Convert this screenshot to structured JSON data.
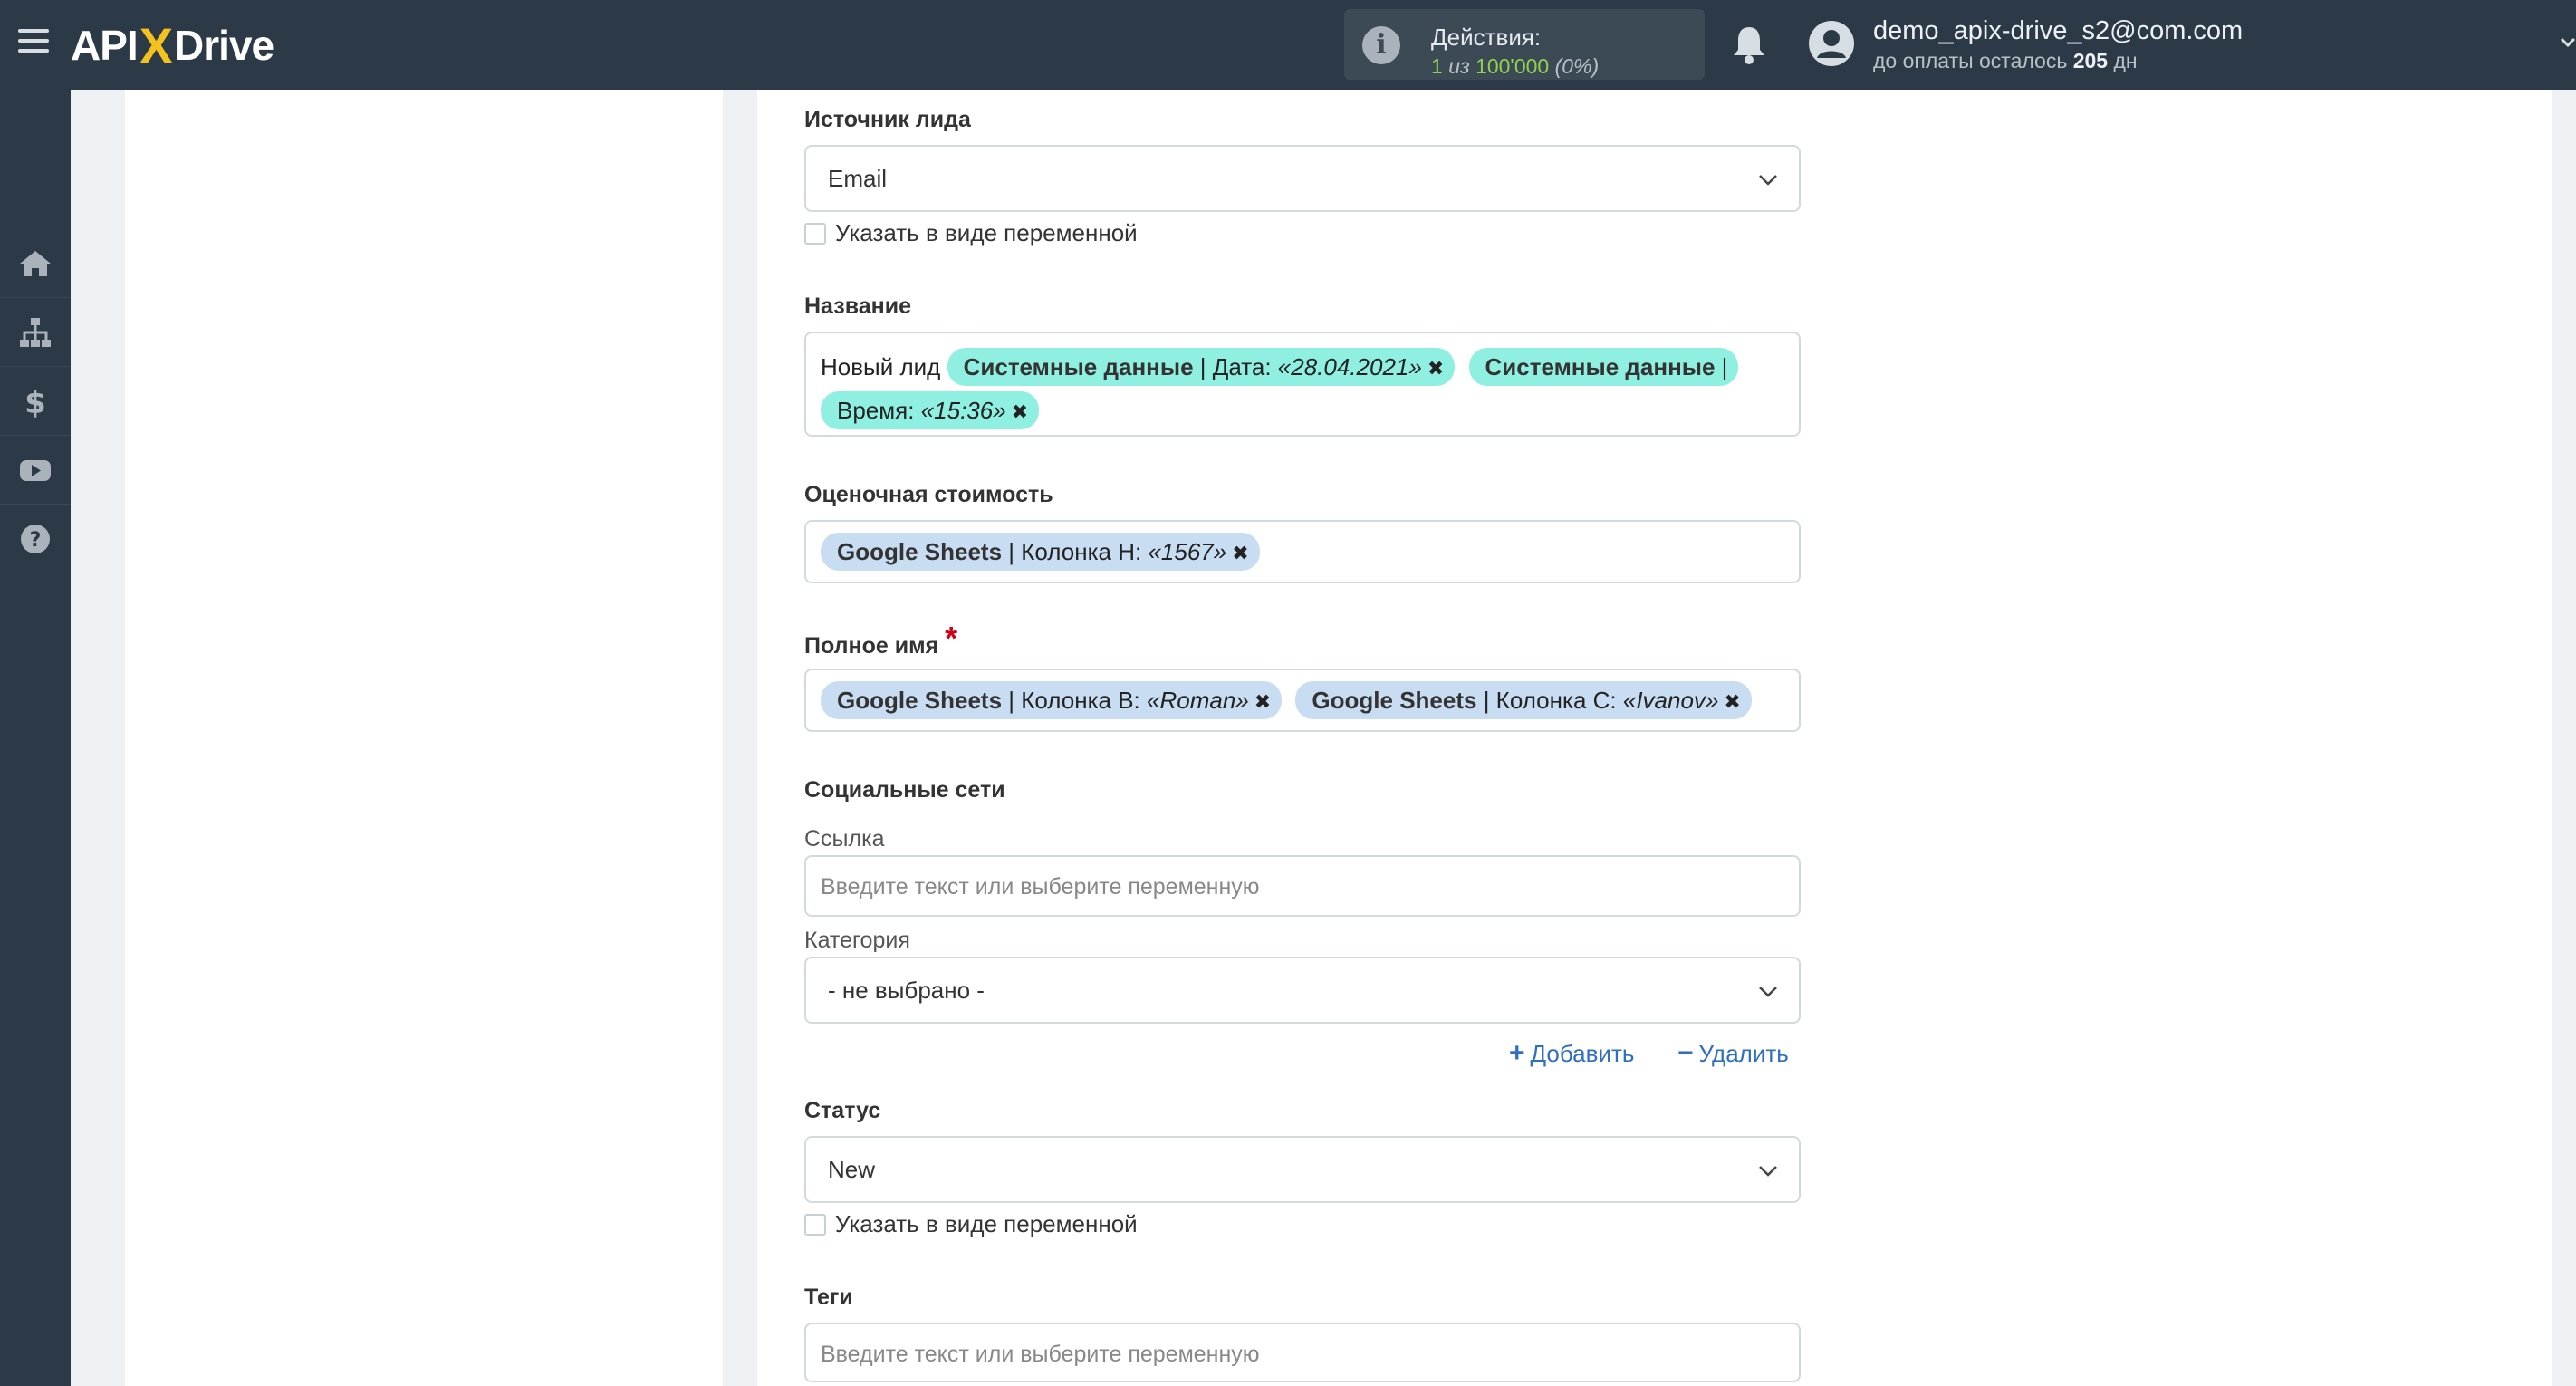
{
  "header": {
    "logo_api": "API",
    "logo_x": "X",
    "logo_drive": "Drive",
    "actions": {
      "title": "Действия:",
      "used": "1",
      "of_text": "из",
      "limit": "100'000",
      "percent": "(0%)"
    },
    "user": {
      "email": "demo_apix-drive_s2@com.com",
      "sub_prefix": "до оплаты осталось",
      "days": "205",
      "sub_suffix": "дн"
    }
  },
  "sidebar": {
    "items": [
      {
        "icon": "home-icon"
      },
      {
        "icon": "sitemap-icon"
      },
      {
        "icon": "dollar-icon"
      },
      {
        "icon": "youtube-icon"
      },
      {
        "icon": "help-icon"
      }
    ]
  },
  "form": {
    "lead_source": {
      "label": "Источник лида",
      "value": "Email",
      "checkbox_label": "Указать в виде переменной"
    },
    "name": {
      "label": "Название",
      "prefix_text": "Новый лид",
      "tags": [
        {
          "source": "Системные данные",
          "field": "| Дата:",
          "value": "«28.04.2021»"
        },
        {
          "source": "Системные данные",
          "field": "| Время:",
          "value": "«15:36»"
        }
      ]
    },
    "estimated_cost": {
      "label": "Оценочная стоимость",
      "tags": [
        {
          "source": "Google Sheets",
          "field": "| Колонка H:",
          "value": "«1567»"
        }
      ]
    },
    "full_name": {
      "label": "Полное имя",
      "required_mark": "*",
      "tags": [
        {
          "source": "Google Sheets",
          "field": "| Колонка B:",
          "value": "«Roman»"
        },
        {
          "source": "Google Sheets",
          "field": "| Колонка C:",
          "value": "«Ivanov»"
        }
      ]
    },
    "social": {
      "label": "Социальные сети",
      "link_label": "Ссылка",
      "link_placeholder": "Введите текст или выберите переменную",
      "category_label": "Категория",
      "category_value": "- не выбрано -",
      "add_label": "Добавить",
      "remove_label": "Удалить"
    },
    "status": {
      "label": "Статус",
      "value": "New",
      "checkbox_label": "Указать в виде переменной"
    },
    "tags_field": {
      "label": "Теги",
      "placeholder": "Введите текст или выберите переменную"
    }
  },
  "colors": {
    "topbar": "#2c3a47",
    "accent_link": "#2f6fbf",
    "tag_system": "#8ff0e2",
    "tag_sheets": "#c8dcf2",
    "required": "#d0021b",
    "actions_green": "#8fd14f"
  }
}
